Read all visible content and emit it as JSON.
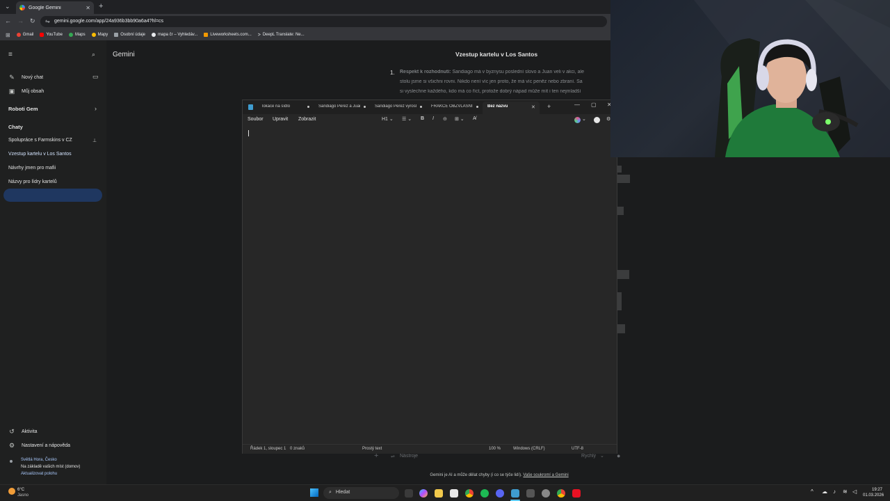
{
  "browser": {
    "tab_title": "Google Gemini",
    "url": "gemini.google.com/app/24a936b3bb90a6a4?hl=cs",
    "bookmarks": [
      "Gmail",
      "YouTube",
      "Maps",
      "Mapy",
      "Osobní údaje",
      "mapa čr – Vyhledáv...",
      "Liveworksheets.com...",
      "DeepL Translate: Ne..."
    ]
  },
  "gemini": {
    "brand": "Gemini",
    "new_chat": "Nový chat",
    "my_content": "Můj obsah",
    "gems_header": "Roboti Gem",
    "chats_header": "Chaty",
    "chats": [
      "Spolupráce s Farmskins v CZ",
      "Vzestup kartelu v Los Santos",
      "Návrhy jmen pro mafii",
      "Názvy pro lídry kartelů"
    ],
    "activity": "Aktivita",
    "settings": "Nastavení a nápověda",
    "location": {
      "place": "Světlá Hora, Česko",
      "basis": "Na základě vašich míst (domov)",
      "update": "Aktualizovat polohu"
    },
    "conversation_title": "Vzestup kartelu v Los Santos",
    "list_number": "1.",
    "answer_lines": [
      {
        "bold": "Respekt k rozhodnutí:",
        "text": " Sandiago má v byznysu poslední slovo a Juan veli v akci, ale"
      },
      {
        "bold": "",
        "text": "stolu jsme si všichni rovni. Nikdo není víc jen proto, že má víc peněz nebo zbraní. Sa"
      },
      {
        "bold": "",
        "text": "si vyslechne každého, kdo má co říct, protože dobrý nápad může mít i ten nejmladší"
      }
    ],
    "prompt_placeholder": "Nástroje",
    "prompt_mode": "Rychlý",
    "disclaimer": "Gemini je AI a může dělat chyby (i co se týče lidí).",
    "disclaimer_link": "Vaše soukromí a Gemini"
  },
  "notepad": {
    "tabs": [
      "lokace na sídlo",
      "Sandiago Perez a Juar",
      "Sandiago Perez vyrosl",
      "FRAKCE OBZVLAŠNÍ R",
      "Bez názvu"
    ],
    "menu": [
      "Soubor",
      "Upravit",
      "Zobrazit"
    ],
    "heading_dropdown": "H1",
    "status": {
      "position": "Řádek 1, sloupec 1",
      "chars": "0 znaků",
      "format": "Prostý text",
      "zoom": "100 %",
      "line_ending": "Windows (CRLF)",
      "encoding": "UTF-8"
    }
  },
  "taskbar": {
    "weather_temp": "6°C",
    "weather_desc": "Jasno",
    "search": "Hledat",
    "time": "19:27",
    "date": "01.03.2026"
  }
}
